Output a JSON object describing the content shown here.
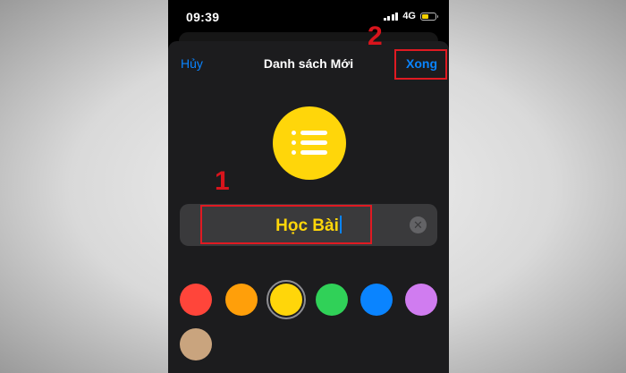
{
  "status_bar": {
    "time": "09:39",
    "network": "4G",
    "signal_icon": "signal-bars-icon",
    "battery_icon": "battery-icon",
    "battery_level": 0.55,
    "battery_color": "#f5d100"
  },
  "nav": {
    "cancel_label": "Hủy",
    "title": "Danh sách Mới",
    "done_label": "Xong"
  },
  "list_icon": {
    "icon": "list-bullet-icon",
    "color": "#ffd60a"
  },
  "name_field": {
    "value": "Học Bài",
    "clear_icon": "clear-x-icon",
    "clear_glyph": "✕"
  },
  "colors": [
    {
      "name": "red",
      "hex": "#ff453a",
      "selected": false
    },
    {
      "name": "orange",
      "hex": "#ff9f0a",
      "selected": false
    },
    {
      "name": "yellow",
      "hex": "#ffd60a",
      "selected": true
    },
    {
      "name": "green",
      "hex": "#30d158",
      "selected": false
    },
    {
      "name": "blue",
      "hex": "#0a84ff",
      "selected": false
    },
    {
      "name": "purple",
      "hex": "#d07cf0",
      "selected": false
    },
    {
      "name": "brown",
      "hex": "#c9a47e",
      "selected": false
    }
  ],
  "annotations": {
    "step1": "1",
    "step2": "2",
    "highlight_color": "#e01a22"
  }
}
